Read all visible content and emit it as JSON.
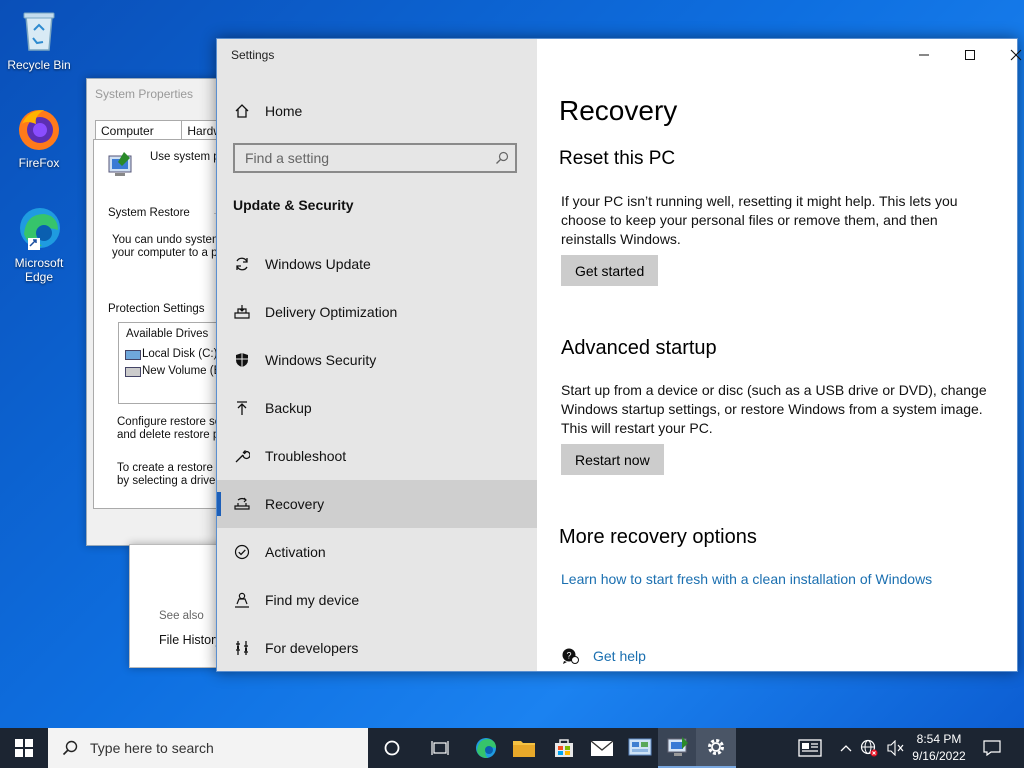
{
  "desktop": {
    "icons": [
      {
        "label": "Recycle Bin",
        "icon": "recycle-bin-icon"
      },
      {
        "label": "FireFox",
        "icon": "firefox-icon"
      },
      {
        "label": "Microsoft Edge",
        "icon": "edge-icon"
      }
    ]
  },
  "system_properties": {
    "title": "System Properties",
    "tabs": [
      "Computer Name",
      "Hardw"
    ],
    "use_system_pr": "Use system pr",
    "system_restore": "System Restore",
    "undo_line1": "You can undo system",
    "undo_line2": "your computer to a pre",
    "protection_settings": "Protection Settings",
    "available_drives": "Available Drives",
    "drive1": "Local Disk (C:) (",
    "drive2": "New Volume (E",
    "configure_line1": "Configure restore sett",
    "configure_line2": "and delete restore po",
    "create_line1": "To create a restore p",
    "create_line2": "by selecting a drive a",
    "see_also": "See also",
    "file_history": "File History"
  },
  "settings": {
    "window_title": "Settings",
    "controls": {
      "minimize": "—",
      "maximize": "☐",
      "close": "✕"
    },
    "nav": {
      "home": "Home",
      "search_placeholder": "Find a setting",
      "section": "Update & Security",
      "items": [
        {
          "label": "Windows Update",
          "icon": "sync-icon"
        },
        {
          "label": "Delivery Optimization",
          "icon": "delivery-optimization-icon"
        },
        {
          "label": "Windows Security",
          "icon": "shield-icon"
        },
        {
          "label": "Backup",
          "icon": "backup-arrow-icon"
        },
        {
          "label": "Troubleshoot",
          "icon": "wrench-icon"
        },
        {
          "label": "Recovery",
          "icon": "recovery-icon",
          "selected": true
        },
        {
          "label": "Activation",
          "icon": "checkmark-circle-icon"
        },
        {
          "label": "Find my device",
          "icon": "person-pin-icon"
        },
        {
          "label": "For developers",
          "icon": "developer-tools-icon"
        }
      ]
    },
    "content": {
      "title": "Recovery",
      "reset": {
        "heading": "Reset this PC",
        "line1": "If your PC isn’t running well, resetting it might help. This lets you",
        "line2": "choose to keep your personal files or remove them, and then",
        "line3": "reinstalls Windows.",
        "button": "Get started"
      },
      "advanced": {
        "heading": "Advanced startup",
        "line1": "Start up from a device or disc (such as a USB drive or DVD), change",
        "line2": "Windows startup settings, or restore Windows from a system image.",
        "line3": "This will restart your PC.",
        "button": "Restart now"
      },
      "more": {
        "heading": "More recovery options",
        "link": "Learn how to start fresh with a clean installation of Windows"
      },
      "help": "Get help"
    }
  },
  "taskbar": {
    "search_placeholder": "Type here to search",
    "time": "8:54 PM",
    "date": "9/16/2022",
    "accent": "#1d5fb8"
  }
}
